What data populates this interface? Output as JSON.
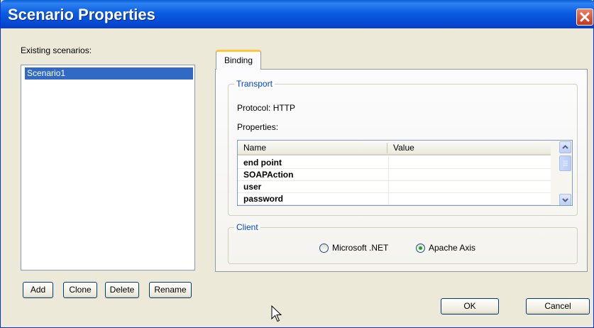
{
  "window": {
    "title": "Scenario Properties"
  },
  "scenarios": {
    "label": "Existing scenarios:",
    "items": [
      "Scenario1"
    ],
    "buttons": {
      "add": "Add",
      "clone": "Clone",
      "delete": "Delete",
      "rename": "Rename"
    }
  },
  "tabs": [
    {
      "label": "Binding",
      "selected": true
    }
  ],
  "transport": {
    "legend": "Transport",
    "protocol": "Protocol: HTTP",
    "properties_label": "Properties:",
    "table": {
      "columns": [
        "Name",
        "Value"
      ],
      "rows": [
        {
          "name": "end point",
          "value": ""
        },
        {
          "name": "SOAPAction",
          "value": ""
        },
        {
          "name": "user",
          "value": ""
        },
        {
          "name": "password",
          "value": ""
        }
      ]
    }
  },
  "client": {
    "legend": "Client",
    "options": [
      {
        "label": "Microsoft .NET",
        "checked": false
      },
      {
        "label": "Apache Axis",
        "checked": true
      }
    ]
  },
  "dialog_buttons": {
    "ok": "OK",
    "cancel": "Cancel"
  },
  "colors": {
    "title_bar": "#0b5de3",
    "selection": "#316ac5",
    "legend_text": "#0046d5",
    "dialog_bg": "#ece9d8"
  },
  "icons": [
    "close-icon",
    "scroll-up-icon",
    "scroll-down-icon",
    "mouse-pointer-icon"
  ]
}
